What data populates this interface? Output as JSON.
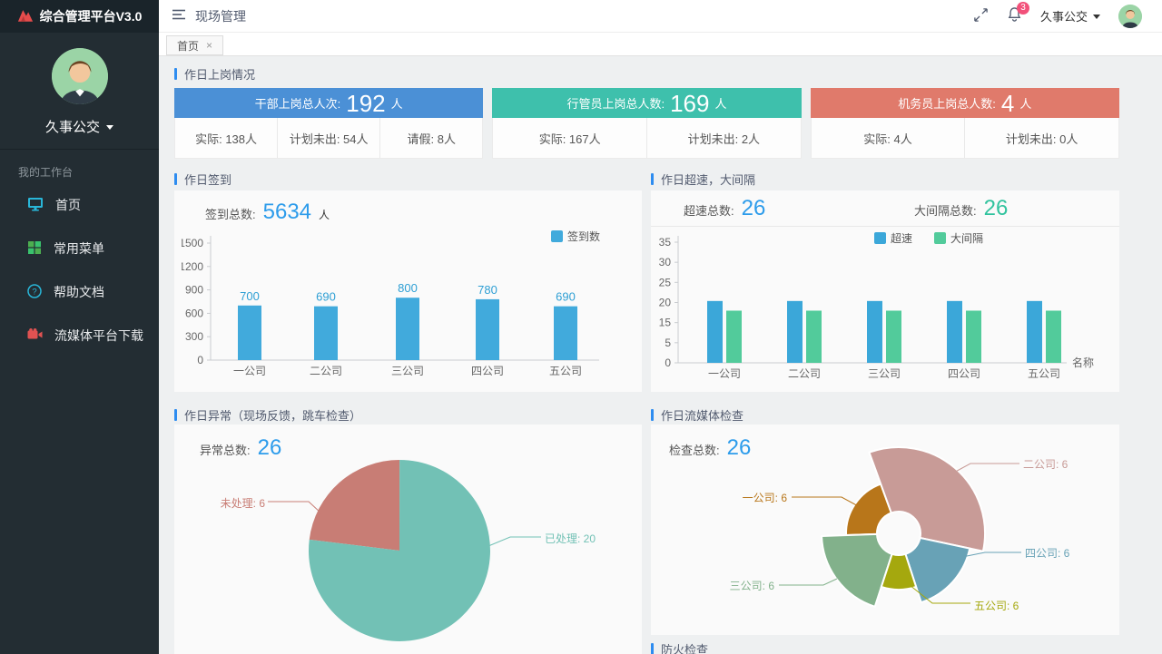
{
  "app": {
    "title": "综合管理平台V3.0"
  },
  "topbar": {
    "page_title": "现场管理",
    "notification_count": "3",
    "user_name": "久事公交"
  },
  "sidebar": {
    "org_name": "久事公交",
    "section_label": "我的工作台",
    "menu": [
      {
        "label": "首页",
        "icon": "monitor-icon"
      },
      {
        "label": "常用菜单",
        "icon": "grid-icon"
      },
      {
        "label": "帮助文档",
        "icon": "help-icon"
      },
      {
        "label": "流媒体平台下载",
        "icon": "video-camera-icon"
      }
    ]
  },
  "tabs": [
    {
      "label": "首页",
      "close": "×"
    }
  ],
  "colors": {
    "accent": "#2d8cf0",
    "stat_blue": "#2d9ceb",
    "stat_green": "#31c39e"
  },
  "sections": {
    "duty": {
      "title": "作日上岗情况",
      "cards": [
        {
          "header_label": "干部上岗总人次:",
          "value": "192",
          "unit": "人",
          "color": "#4b90d6",
          "stats": [
            {
              "text": "实际: 138人"
            },
            {
              "text": "计划未出: 54人"
            },
            {
              "text": "请假: 8人"
            }
          ]
        },
        {
          "header_label": "行管员上岗总人数:",
          "value": "169",
          "unit": "人",
          "color": "#3ec0ac",
          "stats": [
            {
              "text": "实际: 167人"
            },
            {
              "text": "计划未出: 2人"
            }
          ]
        },
        {
          "header_label": "机务员上岗总人数:",
          "value": "4",
          "unit": "人",
          "color": "#e07a6b",
          "stats": [
            {
              "text": "实际: 4人"
            },
            {
              "text": "计划未出: 0人"
            }
          ]
        }
      ]
    },
    "signin": {
      "title": "作日签到",
      "total_label": "签到总数:",
      "total": "5634",
      "unit": "人"
    },
    "speed": {
      "title": "作日超速，大间隔",
      "stat1_label": "超速总数:",
      "stat1": "26",
      "stat2_label": "大间隔总数:",
      "stat2": "26"
    },
    "abnormal": {
      "title": "作日异常（现场反馈，跳车检查）",
      "total_label": "异常总数:",
      "total": "26"
    },
    "media": {
      "title": "作日流媒体检查",
      "total_label": "检查总数:",
      "total": "26"
    },
    "fire": {
      "title": "防火检查"
    }
  },
  "chart_data": [
    {
      "id": "signin-bar",
      "type": "bar",
      "categories": [
        "一公司",
        "二公司",
        "三公司",
        "四公司",
        "五公司"
      ],
      "series": [
        {
          "name": "签到数",
          "color": "#41aadc",
          "values": [
            700,
            690,
            800,
            780,
            690
          ]
        }
      ],
      "yticks": [
        "0",
        "300",
        "600",
        "900",
        "1200",
        "1500"
      ],
      "ylim": [
        0,
        1500
      ],
      "value_labels": true,
      "legend_position": "top-right",
      "grid": false
    },
    {
      "id": "speed-bar",
      "type": "bar",
      "categories": [
        "一公司",
        "二公司",
        "三公司",
        "四公司",
        "五公司"
      ],
      "series": [
        {
          "name": "超速",
          "color": "#3ba7d9",
          "values": [
            20.5,
            20.5,
            20.5,
            20.5,
            20.5
          ]
        },
        {
          "name": "大间隔",
          "color": "#52cb9b",
          "values": [
            17.3,
            17.3,
            17.3,
            17.3,
            17.3
          ]
        }
      ],
      "yticks": [
        "0",
        "5",
        "15",
        "20",
        "25",
        "30",
        "35"
      ],
      "ylim": [
        0,
        40
      ],
      "xlabel": "名称",
      "value_labels": false,
      "legend_position": "top-right",
      "grid": false
    },
    {
      "id": "abnormal-pie",
      "type": "pie",
      "start_angle": 277,
      "slices": [
        {
          "name": "未处理",
          "value": 6,
          "label": "未处理: 6",
          "color": "#c87d75"
        },
        {
          "name": "已处理",
          "value": 20,
          "label": "已处理: 20",
          "color": "#72c1b5"
        }
      ]
    },
    {
      "id": "media-rose",
      "type": "rose",
      "inner_radius": 24,
      "slices": [
        {
          "name": "一公司",
          "value": 6,
          "label": "一公司: 6",
          "color": "#b8761a",
          "radius": 58,
          "start": 268,
          "span": 72
        },
        {
          "name": "二公司",
          "value": 6,
          "label": "二公司: 6",
          "color": "#c89b97",
          "radius": 95,
          "start": 340,
          "span": 122
        },
        {
          "name": "三公司",
          "value": 6,
          "label": "三公司: 6",
          "color": "#82b18b",
          "radius": 85,
          "start": 198,
          "span": 70
        },
        {
          "name": "四公司",
          "value": 6,
          "label": "四公司: 6",
          "color": "#68a2b6",
          "radius": 80,
          "start": 102,
          "span": 60
        },
        {
          "name": "五公司",
          "value": 6,
          "label": "五公司: 6",
          "color": "#a5a80e",
          "radius": 62,
          "start": 162,
          "span": 36
        }
      ]
    }
  ]
}
